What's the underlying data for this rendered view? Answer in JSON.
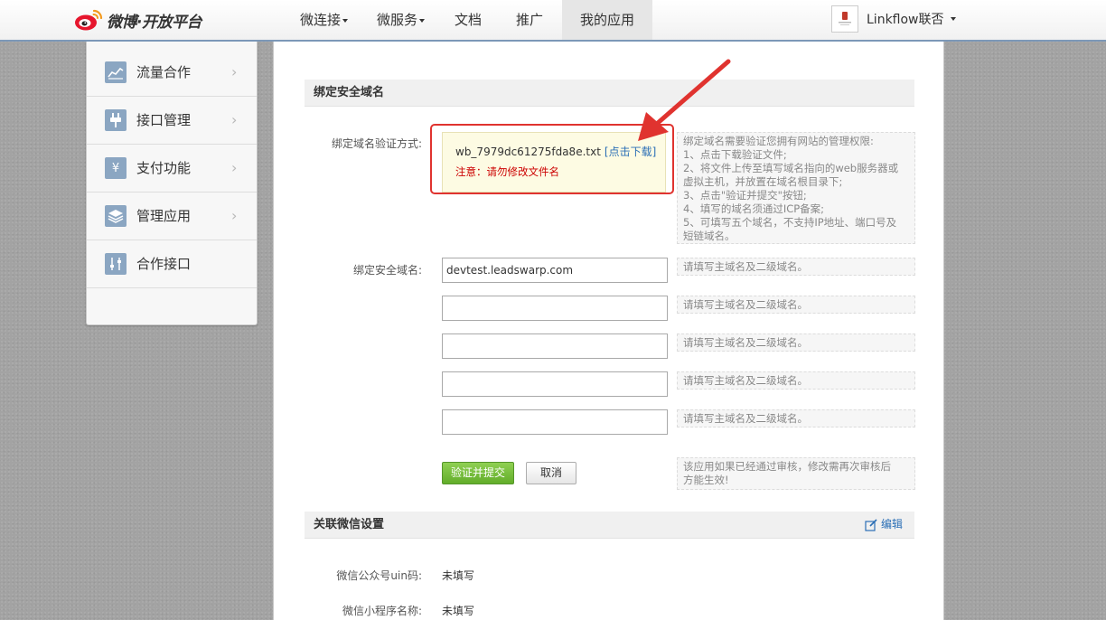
{
  "topnav": {
    "logo_text": "微博·开放平台",
    "items": [
      {
        "label": "微连接",
        "has_caret": true
      },
      {
        "label": "微服务",
        "has_caret": true
      },
      {
        "label": "文档",
        "has_caret": false
      },
      {
        "label": "推广",
        "has_caret": false
      },
      {
        "label": "我的应用",
        "has_caret": false
      }
    ],
    "active_item": "我的应用",
    "user_name": "Linkflow联否"
  },
  "sidebar": {
    "items": [
      {
        "label": "流量合作",
        "icon": "chart-icon"
      },
      {
        "label": "接口管理",
        "icon": "plug-icon"
      },
      {
        "label": "支付功能",
        "icon": "yen-icon"
      },
      {
        "label": "管理应用",
        "icon": "layers-icon"
      },
      {
        "label": "合作接口",
        "icon": "sliders-icon"
      }
    ]
  },
  "bind_domain": {
    "section_title": "绑定安全域名",
    "verify_label": "绑定域名验证方式:",
    "file_name": "wb_7979dc61275fda8e.txt",
    "download_label": "[点击下载]",
    "warning": "注意：请勿修改文件名",
    "instructions": [
      "绑定域名需要验证您拥有网站的管理权限:",
      "1、点击下载验证文件;",
      "2、将文件上传至填写域名指向的web服务器或",
      "虚拟主机，并放置在域名根目录下;",
      "3、点击\"验证并提交\"按钮;",
      "4、填写的域名须通过ICP备案;",
      "5、可填写五个域名，不支持IP地址、端口号及",
      "短链域名。"
    ],
    "domain_label": "绑定安全域名:",
    "domain_values": [
      "devtest.leadswarp.com",
      "",
      "",
      "",
      ""
    ],
    "domain_hint": "请填写主域名及二级域名。",
    "submit_label": "验证并提交",
    "cancel_label": "取消",
    "review_note": [
      "该应用如果已经通过审核，修改需再次审核后",
      "方能生效!"
    ]
  },
  "wechat": {
    "section_title": "关联微信设置",
    "edit_label": "编辑",
    "uin_label": "微信公众号uin码:",
    "uin_value": "未填写",
    "miniapp_label": "微信小程序名称:",
    "miniapp_value": "未填写"
  },
  "colors": {
    "nav_border": "#7c98b8",
    "sidebar_icon": "#8ba6c2",
    "link": "#2b6fb6",
    "warning": "#cc0000",
    "annotation_red": "#e0332f",
    "submit_green": "#62ad2a"
  }
}
